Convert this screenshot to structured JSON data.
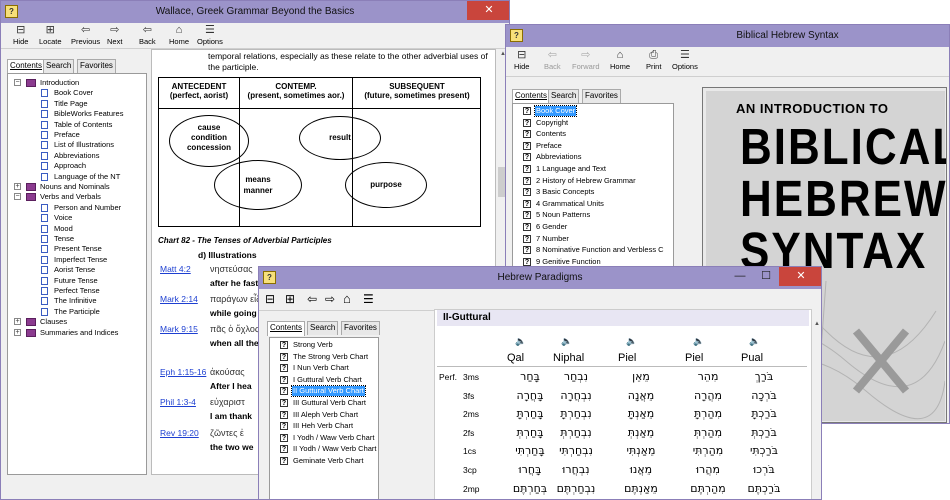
{
  "wallace": {
    "title": "Wallace, Greek Grammar Beyond the Basics",
    "controls": {
      "min": "—",
      "max": "☐",
      "close": "✕"
    },
    "toolbar": [
      {
        "name": "hide",
        "label": "Hide",
        "icon": "hide-icon"
      },
      {
        "name": "locate",
        "label": "Locate",
        "icon": "locate-icon"
      },
      {
        "name": "previous",
        "label": "Previous",
        "icon": "previous-icon"
      },
      {
        "name": "next",
        "label": "Next",
        "icon": "next-icon"
      },
      {
        "name": "back",
        "label": "Back",
        "icon": "back-icon"
      },
      {
        "name": "home",
        "label": "Home",
        "icon": "home-icon"
      },
      {
        "name": "options",
        "label": "Options",
        "icon": "options-icon"
      }
    ],
    "tabs": [
      "Contents",
      "Search",
      "Favorites"
    ],
    "tree": [
      {
        "label": "Introduction",
        "type": "book",
        "expander": "−"
      },
      {
        "label": "Book Cover",
        "type": "page"
      },
      {
        "label": "Title Page",
        "type": "page"
      },
      {
        "label": "BibleWorks Features",
        "type": "page"
      },
      {
        "label": "Table of Contents",
        "type": "page"
      },
      {
        "label": "Preface",
        "type": "page"
      },
      {
        "label": "List of Illustrations",
        "type": "page"
      },
      {
        "label": "Abbreviations",
        "type": "page"
      },
      {
        "label": "Approach",
        "type": "page"
      },
      {
        "label": "Language of the NT",
        "type": "page"
      },
      {
        "label": "Nouns and Nominals",
        "type": "book",
        "expander": "+"
      },
      {
        "label": "Verbs and Verbals",
        "type": "book",
        "expander": "−"
      },
      {
        "label": "Person and Number",
        "type": "page"
      },
      {
        "label": "Voice",
        "type": "page"
      },
      {
        "label": "Mood",
        "type": "page"
      },
      {
        "label": "Tense",
        "type": "page"
      },
      {
        "label": "Present Tense",
        "type": "page"
      },
      {
        "label": "Imperfect Tense",
        "type": "page"
      },
      {
        "label": "Aorist Tense",
        "type": "page"
      },
      {
        "label": "Future Tense",
        "type": "page"
      },
      {
        "label": "Perfect Tense",
        "type": "page"
      },
      {
        "label": "The Infinitive",
        "type": "page"
      },
      {
        "label": "The Participle",
        "type": "page"
      },
      {
        "label": "Clauses",
        "type": "book",
        "expander": "+"
      },
      {
        "label": "Summaries and Indices",
        "type": "book",
        "expander": "+"
      }
    ],
    "content": {
      "intro_line1": "temporal relations, especially as these relate to the other adverbial uses of",
      "intro_line2": "the participle.",
      "table_headers": [
        {
          "title": "ANTECEDENT",
          "sub": "(perfect, aorist)"
        },
        {
          "title": "CONTEMP.",
          "sub": "(present, sometimes aor.)"
        },
        {
          "title": "SUBSEQUENT",
          "sub": "(future, sometimes present)"
        }
      ],
      "ovals": {
        "cause": [
          "cause",
          "condition",
          "concession"
        ],
        "result": [
          "result"
        ],
        "means": [
          "means",
          "manner"
        ],
        "purpose": [
          "purpose"
        ]
      },
      "chart_caption": "Chart 82 - The Tenses of Adverbial Participles",
      "section": "d) Illustrations",
      "examples": [
        {
          "ref": "Matt 4:2",
          "greek": "νηστεύσας",
          "trans": "after he fast"
        },
        {
          "ref": "Mark 2:14",
          "greek": "παράγων εἶδ",
          "trans": "while going"
        },
        {
          "ref": "Mark 9:15",
          "greek": "πᾶς ὁ ὄχλος ἰ",
          "trans": "when all the"
        },
        {
          "ref": "Eph 1:15-16",
          "greek": "ἀκούσας",
          "trans": "After I hea"
        },
        {
          "ref": "Phil 1:3-4",
          "greek": "εὐχαριστ",
          "trans": "I am thank"
        },
        {
          "ref": "Rev 19:20",
          "greek": "ζῶντες ἐ",
          "trans": "the two we"
        }
      ]
    }
  },
  "hebrew_syntax": {
    "title": "Biblical Hebrew Syntax",
    "toolbar": [
      {
        "name": "hide",
        "label": "Hide",
        "icon": "hide-icon",
        "disabled": false
      },
      {
        "name": "back",
        "label": "Back",
        "icon": "back-icon",
        "disabled": true
      },
      {
        "name": "forward",
        "label": "Forward",
        "icon": "forward-icon",
        "disabled": true
      },
      {
        "name": "home",
        "label": "Home",
        "icon": "home-icon",
        "disabled": false
      },
      {
        "name": "print",
        "label": "Print",
        "icon": "print-icon",
        "disabled": false
      },
      {
        "name": "options",
        "label": "Options",
        "icon": "options-icon",
        "disabled": false
      }
    ],
    "tabs": [
      "Contents",
      "Search",
      "Favorites"
    ],
    "list": [
      "Book Cover",
      "Copyright",
      "Contents",
      "Preface",
      "Abbreviations",
      "1 Language and Text",
      "2 History of Hebrew Grammar",
      "3 Basic Concepts",
      "4 Grammatical Units",
      "5 Noun Patterns",
      "6 Gender",
      "7 Number",
      "8 Nominative Function and Verbless C",
      "9 Genitive Function"
    ],
    "selected_index": 0,
    "cover": {
      "line1": "AN INTRODUCTION TO",
      "line2": "BIBLICAL",
      "line3": "HEBREW",
      "line4": "SYNTAX"
    }
  },
  "paradigms": {
    "title": "Hebrew Paradigms",
    "tabs": [
      "Contents",
      "Search",
      "Favorites"
    ],
    "list": [
      "Strong Verb",
      "The Strong Verb Chart",
      "I Nun Verb Chart",
      "I Guttural Verb Chart",
      "II Guttural Verb Chart",
      "III Guttural Verb Chart",
      "III Aleph Verb Chart",
      "III Heh Verb Chart",
      "I Yodh / Waw Verb Chart",
      "II Yodh / Waw Verb Chart",
      "Geminate Verb Chart"
    ],
    "selected_index": 4,
    "heading": "II-Guttural",
    "columns": [
      "Qal",
      "Niphal",
      "Piel",
      "Piel",
      "Pual"
    ],
    "row_group": "Perf.",
    "rows": [
      {
        "pgn": "3ms",
        "cells": [
          "בָּחַר",
          "נִבְחַר",
          "מֵאֵן",
          "מִהֵר",
          "בֹּרַךְ"
        ]
      },
      {
        "pgn": "3fs",
        "cells": [
          "בָּחֲרָה",
          "נִבְחֲרָה",
          "מֵאֲנָה",
          "מִהֲרָה",
          "בֹּרְכָה"
        ]
      },
      {
        "pgn": "2ms",
        "cells": [
          "בָּחַרְתָּ",
          "נִבְחַרְתָּ",
          "מֵאַנְתָּ",
          "מִהַרְתָּ",
          "בֹּרַכְתָּ"
        ]
      },
      {
        "pgn": "2fs",
        "cells": [
          "בָּחַרְתְּ",
          "נִבְחַרְתְּ",
          "מֵאַנְתְּ",
          "מִהַרְתְּ",
          "בֹּרַכְתְּ"
        ]
      },
      {
        "pgn": "1cs",
        "cells": [
          "בָּחַרְתִּי",
          "נִבְחַרְתִּי",
          "מֵאַנְתִּי",
          "מִהַרְתִּי",
          "בֹּרַכְתִּי"
        ]
      },
      {
        "pgn": "3cp",
        "cells": [
          "בָּחֲרוּ",
          "נִבְחֲרוּ",
          "מֵאֲנוּ",
          "מִהֲרוּ",
          "בֹּרְכוּ"
        ]
      },
      {
        "pgn": "2mp",
        "cells": [
          "בְּחַרְתֶּם",
          "נִבְחַרְתֶּם",
          "מֵאַנְתֶּם",
          "מִהַרְתֶּם",
          "בֹּרַכְתֶּם"
        ]
      }
    ]
  }
}
